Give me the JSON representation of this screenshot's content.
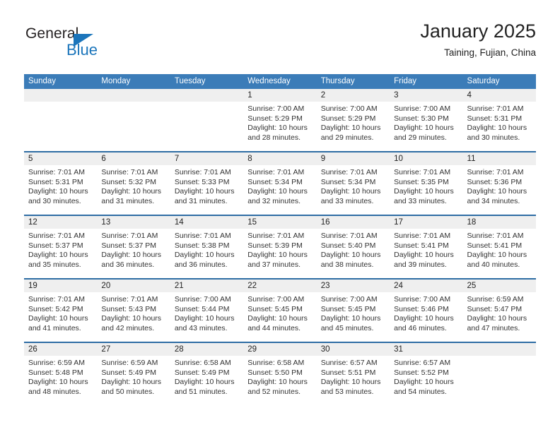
{
  "brand": {
    "name_top": "General",
    "name_bottom": "Blue",
    "triangle_color": "#1b75bb"
  },
  "header": {
    "title": "January 2025",
    "subtitle": "Taining, Fujian, China"
  },
  "theme": {
    "header_blue": "#3b7cb8",
    "row_rule_blue": "#2e6da4",
    "daynum_band": "#efefef"
  },
  "calendar": {
    "weekday_headers": [
      "Sunday",
      "Monday",
      "Tuesday",
      "Wednesday",
      "Thursday",
      "Friday",
      "Saturday"
    ],
    "weeks": [
      [
        {
          "day": "",
          "sunrise": "",
          "sunset": "",
          "daylight_1": "",
          "daylight_2": ""
        },
        {
          "day": "",
          "sunrise": "",
          "sunset": "",
          "daylight_1": "",
          "daylight_2": ""
        },
        {
          "day": "",
          "sunrise": "",
          "sunset": "",
          "daylight_1": "",
          "daylight_2": ""
        },
        {
          "day": "1",
          "sunrise": "Sunrise: 7:00 AM",
          "sunset": "Sunset: 5:29 PM",
          "daylight_1": "Daylight: 10 hours",
          "daylight_2": "and 28 minutes."
        },
        {
          "day": "2",
          "sunrise": "Sunrise: 7:00 AM",
          "sunset": "Sunset: 5:29 PM",
          "daylight_1": "Daylight: 10 hours",
          "daylight_2": "and 29 minutes."
        },
        {
          "day": "3",
          "sunrise": "Sunrise: 7:00 AM",
          "sunset": "Sunset: 5:30 PM",
          "daylight_1": "Daylight: 10 hours",
          "daylight_2": "and 29 minutes."
        },
        {
          "day": "4",
          "sunrise": "Sunrise: 7:01 AM",
          "sunset": "Sunset: 5:31 PM",
          "daylight_1": "Daylight: 10 hours",
          "daylight_2": "and 30 minutes."
        }
      ],
      [
        {
          "day": "5",
          "sunrise": "Sunrise: 7:01 AM",
          "sunset": "Sunset: 5:31 PM",
          "daylight_1": "Daylight: 10 hours",
          "daylight_2": "and 30 minutes."
        },
        {
          "day": "6",
          "sunrise": "Sunrise: 7:01 AM",
          "sunset": "Sunset: 5:32 PM",
          "daylight_1": "Daylight: 10 hours",
          "daylight_2": "and 31 minutes."
        },
        {
          "day": "7",
          "sunrise": "Sunrise: 7:01 AM",
          "sunset": "Sunset: 5:33 PM",
          "daylight_1": "Daylight: 10 hours",
          "daylight_2": "and 31 minutes."
        },
        {
          "day": "8",
          "sunrise": "Sunrise: 7:01 AM",
          "sunset": "Sunset: 5:34 PM",
          "daylight_1": "Daylight: 10 hours",
          "daylight_2": "and 32 minutes."
        },
        {
          "day": "9",
          "sunrise": "Sunrise: 7:01 AM",
          "sunset": "Sunset: 5:34 PM",
          "daylight_1": "Daylight: 10 hours",
          "daylight_2": "and 33 minutes."
        },
        {
          "day": "10",
          "sunrise": "Sunrise: 7:01 AM",
          "sunset": "Sunset: 5:35 PM",
          "daylight_1": "Daylight: 10 hours",
          "daylight_2": "and 33 minutes."
        },
        {
          "day": "11",
          "sunrise": "Sunrise: 7:01 AM",
          "sunset": "Sunset: 5:36 PM",
          "daylight_1": "Daylight: 10 hours",
          "daylight_2": "and 34 minutes."
        }
      ],
      [
        {
          "day": "12",
          "sunrise": "Sunrise: 7:01 AM",
          "sunset": "Sunset: 5:37 PM",
          "daylight_1": "Daylight: 10 hours",
          "daylight_2": "and 35 minutes."
        },
        {
          "day": "13",
          "sunrise": "Sunrise: 7:01 AM",
          "sunset": "Sunset: 5:37 PM",
          "daylight_1": "Daylight: 10 hours",
          "daylight_2": "and 36 minutes."
        },
        {
          "day": "14",
          "sunrise": "Sunrise: 7:01 AM",
          "sunset": "Sunset: 5:38 PM",
          "daylight_1": "Daylight: 10 hours",
          "daylight_2": "and 36 minutes."
        },
        {
          "day": "15",
          "sunrise": "Sunrise: 7:01 AM",
          "sunset": "Sunset: 5:39 PM",
          "daylight_1": "Daylight: 10 hours",
          "daylight_2": "and 37 minutes."
        },
        {
          "day": "16",
          "sunrise": "Sunrise: 7:01 AM",
          "sunset": "Sunset: 5:40 PM",
          "daylight_1": "Daylight: 10 hours",
          "daylight_2": "and 38 minutes."
        },
        {
          "day": "17",
          "sunrise": "Sunrise: 7:01 AM",
          "sunset": "Sunset: 5:41 PM",
          "daylight_1": "Daylight: 10 hours",
          "daylight_2": "and 39 minutes."
        },
        {
          "day": "18",
          "sunrise": "Sunrise: 7:01 AM",
          "sunset": "Sunset: 5:41 PM",
          "daylight_1": "Daylight: 10 hours",
          "daylight_2": "and 40 minutes."
        }
      ],
      [
        {
          "day": "19",
          "sunrise": "Sunrise: 7:01 AM",
          "sunset": "Sunset: 5:42 PM",
          "daylight_1": "Daylight: 10 hours",
          "daylight_2": "and 41 minutes."
        },
        {
          "day": "20",
          "sunrise": "Sunrise: 7:01 AM",
          "sunset": "Sunset: 5:43 PM",
          "daylight_1": "Daylight: 10 hours",
          "daylight_2": "and 42 minutes."
        },
        {
          "day": "21",
          "sunrise": "Sunrise: 7:00 AM",
          "sunset": "Sunset: 5:44 PM",
          "daylight_1": "Daylight: 10 hours",
          "daylight_2": "and 43 minutes."
        },
        {
          "day": "22",
          "sunrise": "Sunrise: 7:00 AM",
          "sunset": "Sunset: 5:45 PM",
          "daylight_1": "Daylight: 10 hours",
          "daylight_2": "and 44 minutes."
        },
        {
          "day": "23",
          "sunrise": "Sunrise: 7:00 AM",
          "sunset": "Sunset: 5:45 PM",
          "daylight_1": "Daylight: 10 hours",
          "daylight_2": "and 45 minutes."
        },
        {
          "day": "24",
          "sunrise": "Sunrise: 7:00 AM",
          "sunset": "Sunset: 5:46 PM",
          "daylight_1": "Daylight: 10 hours",
          "daylight_2": "and 46 minutes."
        },
        {
          "day": "25",
          "sunrise": "Sunrise: 6:59 AM",
          "sunset": "Sunset: 5:47 PM",
          "daylight_1": "Daylight: 10 hours",
          "daylight_2": "and 47 minutes."
        }
      ],
      [
        {
          "day": "26",
          "sunrise": "Sunrise: 6:59 AM",
          "sunset": "Sunset: 5:48 PM",
          "daylight_1": "Daylight: 10 hours",
          "daylight_2": "and 48 minutes."
        },
        {
          "day": "27",
          "sunrise": "Sunrise: 6:59 AM",
          "sunset": "Sunset: 5:49 PM",
          "daylight_1": "Daylight: 10 hours",
          "daylight_2": "and 50 minutes."
        },
        {
          "day": "28",
          "sunrise": "Sunrise: 6:58 AM",
          "sunset": "Sunset: 5:49 PM",
          "daylight_1": "Daylight: 10 hours",
          "daylight_2": "and 51 minutes."
        },
        {
          "day": "29",
          "sunrise": "Sunrise: 6:58 AM",
          "sunset": "Sunset: 5:50 PM",
          "daylight_1": "Daylight: 10 hours",
          "daylight_2": "and 52 minutes."
        },
        {
          "day": "30",
          "sunrise": "Sunrise: 6:57 AM",
          "sunset": "Sunset: 5:51 PM",
          "daylight_1": "Daylight: 10 hours",
          "daylight_2": "and 53 minutes."
        },
        {
          "day": "31",
          "sunrise": "Sunrise: 6:57 AM",
          "sunset": "Sunset: 5:52 PM",
          "daylight_1": "Daylight: 10 hours",
          "daylight_2": "and 54 minutes."
        },
        {
          "day": "",
          "sunrise": "",
          "sunset": "",
          "daylight_1": "",
          "daylight_2": ""
        }
      ]
    ]
  }
}
